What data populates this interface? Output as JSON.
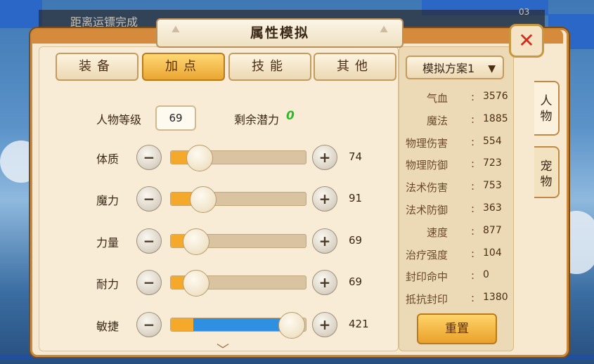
{
  "hud": {
    "left_text": "距离运镖完成",
    "right_text": "03"
  },
  "title": "属性模拟",
  "colors": {
    "accent_gold": "#e9a12a",
    "potential_green": "#2fb82a",
    "close_red": "#d42a1c",
    "slider_blue": "#2f8fe0",
    "slider_orange": "#f4a92a"
  },
  "tabs": [
    {
      "label": "装备",
      "active": false
    },
    {
      "label": "加点",
      "active": true
    },
    {
      "label": "技能",
      "active": false
    },
    {
      "label": "其他",
      "active": false
    }
  ],
  "plan_select": {
    "label": "模拟方案1"
  },
  "level": {
    "label": "人物等级",
    "value": "69"
  },
  "potential": {
    "label": "剩余潜力",
    "value": "0"
  },
  "stats": [
    {
      "name": "体质",
      "value": "74",
      "fraction": 0.14
    },
    {
      "name": "魔力",
      "value": "91",
      "fraction": 0.17
    },
    {
      "name": "力量",
      "value": "69",
      "fraction": 0.11
    },
    {
      "name": "耐力",
      "value": "69",
      "fraction": 0.11
    },
    {
      "name": "敏捷",
      "value": "421",
      "fraction": 0.98
    }
  ],
  "summary": [
    {
      "name": "气血",
      "value": "3576"
    },
    {
      "name": "魔法",
      "value": "1885"
    },
    {
      "name": "物理伤害",
      "value": "554"
    },
    {
      "name": "物理防御",
      "value": "723"
    },
    {
      "name": "法术伤害",
      "value": "753"
    },
    {
      "name": "法术防御",
      "value": "363"
    },
    {
      "name": "速度",
      "value": "877"
    },
    {
      "name": "治疗强度",
      "value": "104"
    },
    {
      "name": "封印命中",
      "value": "0"
    },
    {
      "name": "抵抗封印",
      "value": "1380"
    }
  ],
  "reset_label": "重置",
  "side_tabs": [
    {
      "chars": [
        "人",
        "物"
      ],
      "active": true
    },
    {
      "chars": [
        "宠",
        "物"
      ],
      "active": false
    }
  ],
  "icons": {
    "close": "close-icon",
    "minus": "minus-icon",
    "plus": "plus-icon",
    "chevron": "chevron-down-icon"
  }
}
